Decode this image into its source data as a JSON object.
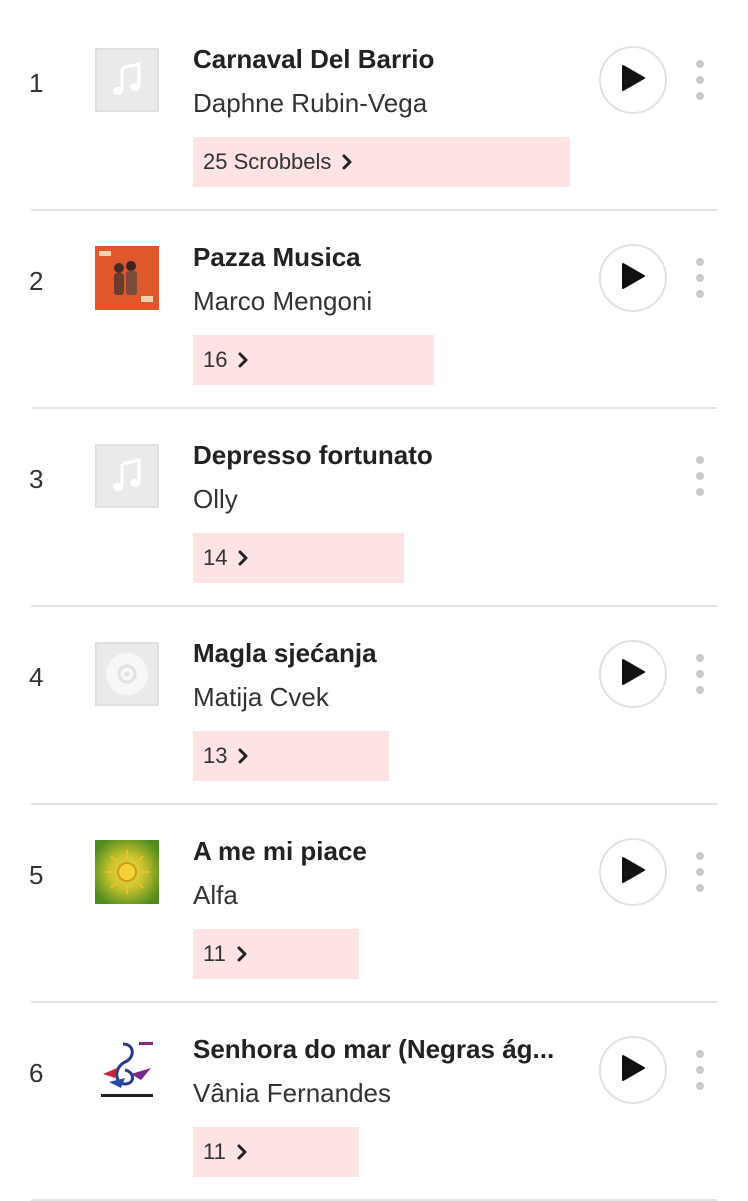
{
  "tracks": [
    {
      "rank": "1",
      "title": "Carnaval Del Barrio",
      "artist": "Daphne Rubin-Vega",
      "scrobbles": "25 Scrobbels",
      "scrobble_fraction": 1.0,
      "art": "music-note-placeholder",
      "has_play": true
    },
    {
      "rank": "2",
      "title": "Pazza Musica",
      "artist": "Marco Mengoni",
      "scrobbles": "16",
      "scrobble_fraction": 0.64,
      "art": "album-cover-orange",
      "has_play": true
    },
    {
      "rank": "3",
      "title": "Depresso fortunato",
      "artist": "Olly",
      "scrobbles": "14",
      "scrobble_fraction": 0.56,
      "art": "music-note-placeholder",
      "has_play": false
    },
    {
      "rank": "4",
      "title": "Magla sjećanja",
      "artist": "Matija Cvek",
      "scrobbles": "13",
      "scrobble_fraction": 0.52,
      "art": "disc-placeholder",
      "has_play": true
    },
    {
      "rank": "5",
      "title": "A me mi piace",
      "artist": "Alfa",
      "scrobbles": "11",
      "scrobble_fraction": 0.44,
      "art": "album-cover-sun",
      "has_play": true
    },
    {
      "rank": "6",
      "title": "Senhora do mar (Negras ág...",
      "artist": "Vânia Fernandes",
      "scrobbles": "11",
      "scrobble_fraction": 0.44,
      "art": "album-cover-eurovision",
      "has_play": true
    }
  ],
  "colors": {
    "scrobble_bar": "#fde3e3",
    "divider": "#e3e3e3",
    "text": "#222222",
    "placeholder_bg": "#eaeaea"
  }
}
